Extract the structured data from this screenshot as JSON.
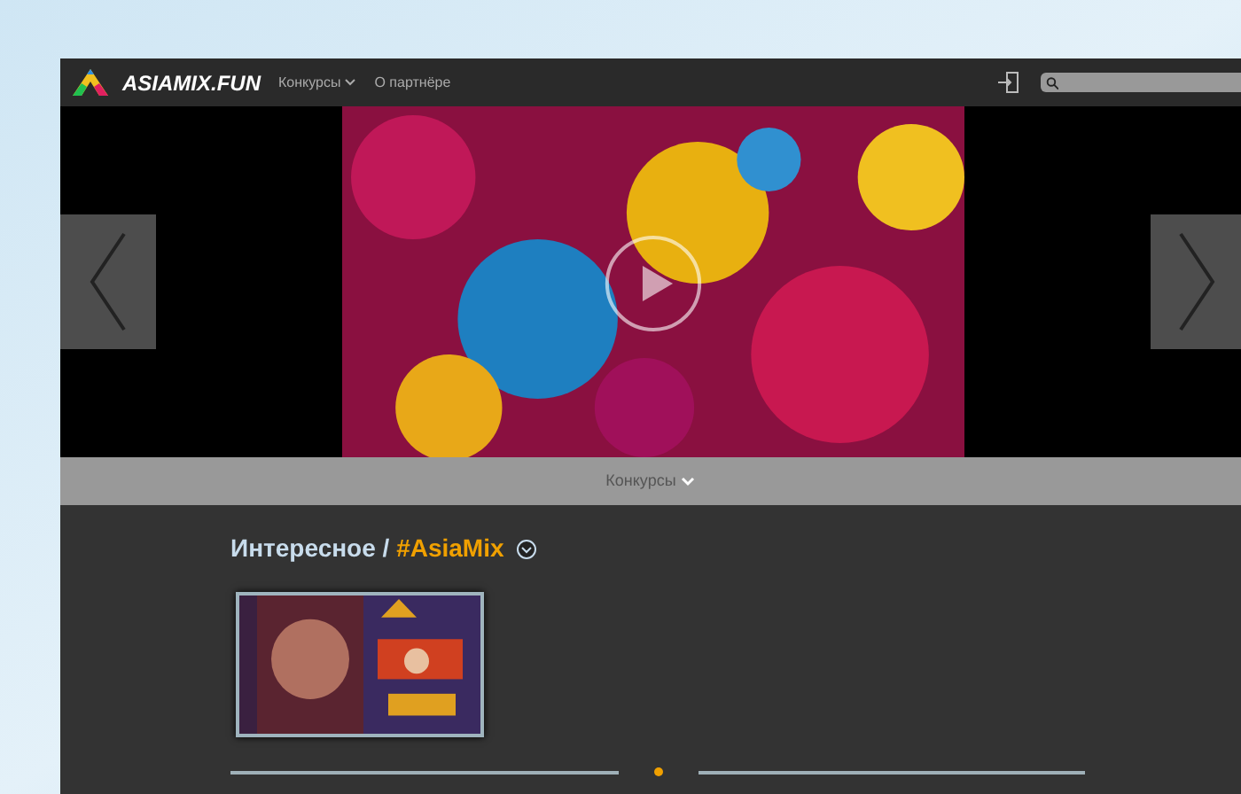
{
  "header": {
    "logo": "ASIAMIX.FUN",
    "nav": [
      {
        "label": "Конкурсы",
        "dropdown": true
      },
      {
        "label": "О партнёре",
        "dropdown": false
      }
    ]
  },
  "category_bar": {
    "label": "Конкурсы"
  },
  "section": {
    "title": "Интересное / ",
    "tag": "#AsiaMix"
  }
}
